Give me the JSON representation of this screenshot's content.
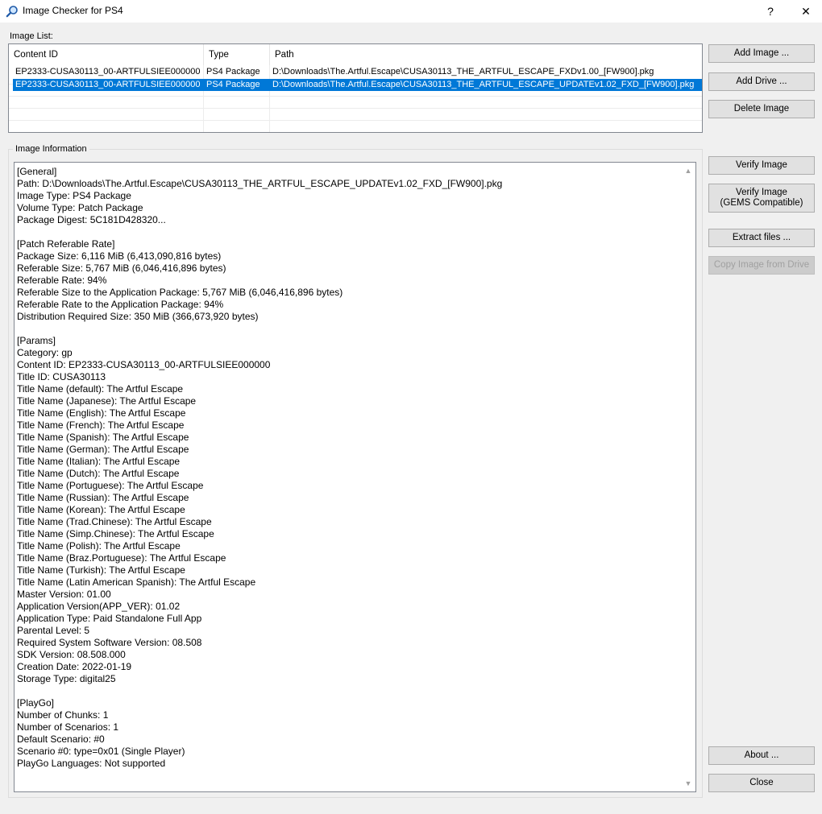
{
  "window": {
    "title": "Image Checker for PS4",
    "help_label": "?",
    "close_label": "✕"
  },
  "image_list": {
    "label": "Image List:",
    "columns": [
      "Content ID",
      "Type",
      "Path"
    ],
    "rows": [
      {
        "content_id": "EP2333-CUSA30113_00-ARTFULSIEE000000",
        "type": "PS4 Package",
        "path": "D:\\Downloads\\The.Artful.Escape\\CUSA30113_THE_ARTFUL_ESCAPE_FXDv1.00_[FW900].pkg",
        "selected": false
      },
      {
        "content_id": "EP2333-CUSA30113_00-ARTFULSIEE000000",
        "type": "PS4 Package",
        "path": "D:\\Downloads\\The.Artful.Escape\\CUSA30113_THE_ARTFUL_ESCAPE_UPDATEv1.02_FXD_[FW900].pkg",
        "selected": true
      }
    ]
  },
  "buttons": {
    "add_image": "Add Image ...",
    "add_drive": "Add Drive ...",
    "delete_image": "Delete Image",
    "verify_image": "Verify Image",
    "verify_image_gems_1": "Verify Image",
    "verify_image_gems_2": "(GEMS Compatible)",
    "extract_files": "Extract files ...",
    "copy_image": "Copy Image from Drive",
    "about": "About ...",
    "close": "Close"
  },
  "image_information": {
    "label": "Image Information",
    "lines": [
      "[General]",
      "Path: D:\\Downloads\\The.Artful.Escape\\CUSA30113_THE_ARTFUL_ESCAPE_UPDATEv1.02_FXD_[FW900].pkg",
      "Image Type: PS4 Package",
      "Volume Type: Patch Package",
      "Package Digest: 5C181D428320...",
      "",
      "[Patch Referable Rate]",
      "Package Size: 6,116 MiB (6,413,090,816 bytes)",
      "Referable Size: 5,767 MiB (6,046,416,896 bytes)",
      "Referable Rate: 94%",
      "Referable Size to the Application Package: 5,767 MiB (6,046,416,896 bytes)",
      "Referable Rate to the Application Package: 94%",
      "Distribution Required Size: 350 MiB (366,673,920 bytes)",
      "",
      "[Params]",
      "Category: gp",
      "Content ID: EP2333-CUSA30113_00-ARTFULSIEE000000",
      "Title ID: CUSA30113",
      "Title Name (default): The Artful Escape",
      "Title Name (Japanese): The Artful Escape",
      "Title Name (English): The Artful Escape",
      "Title Name (French): The Artful Escape",
      "Title Name (Spanish): The Artful Escape",
      "Title Name (German): The Artful Escape",
      "Title Name (Italian): The Artful Escape",
      "Title Name (Dutch): The Artful Escape",
      "Title Name (Portuguese): The Artful Escape",
      "Title Name (Russian): The Artful Escape",
      "Title Name (Korean): The Artful Escape",
      "Title Name (Trad.Chinese): The Artful Escape",
      "Title Name (Simp.Chinese): The Artful Escape",
      "Title Name (Polish): The Artful Escape",
      "Title Name (Braz.Portuguese): The Artful Escape",
      "Title Name (Turkish): The Artful Escape",
      "Title Name (Latin American Spanish): The Artful Escape",
      "Master Version: 01.00",
      "Application Version(APP_VER): 01.02",
      "Application Type: Paid Standalone Full App",
      "Parental Level: 5",
      "Required System Software Version: 08.508",
      "SDK Version: 08.508.000",
      "Creation Date: 2022-01-19",
      "Storage Type: digital25",
      "",
      "[PlayGo]",
      "Number of Chunks: 1",
      "Number of Scenarios: 1",
      "Default Scenario: #0",
      "Scenario #0: type=0x01 (Single Player)",
      "PlayGo Languages: Not supported"
    ]
  },
  "colors": {
    "selection": "#0078d7",
    "button_face": "#e1e1e1",
    "window_bg": "#f0f0f0"
  }
}
